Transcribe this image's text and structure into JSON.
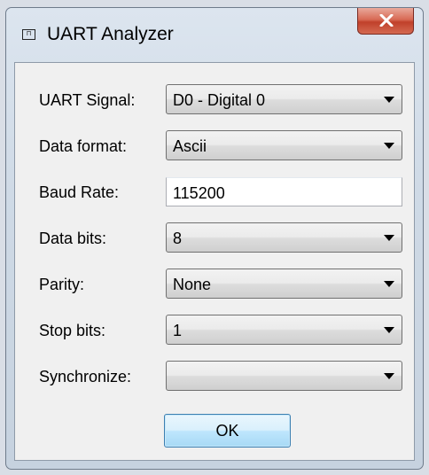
{
  "window": {
    "title": "UART Analyzer",
    "icon": "waveform-window-icon",
    "close_icon": "close-icon"
  },
  "form": {
    "uart_signal": {
      "label": "UART Signal:",
      "value": "D0 - Digital 0"
    },
    "data_format": {
      "label": "Data format:",
      "value": "Ascii"
    },
    "baud_rate": {
      "label": "Baud Rate:",
      "value": "115200"
    },
    "data_bits": {
      "label": "Data bits:",
      "value": "8"
    },
    "parity": {
      "label": "Parity:",
      "value": "None"
    },
    "stop_bits": {
      "label": "Stop bits:",
      "value": "1"
    },
    "synchronize": {
      "label": "Synchronize:",
      "value": ""
    }
  },
  "buttons": {
    "ok": "OK"
  },
  "colors": {
    "close_button": "#c8452f",
    "ok_button_border": "#3c7fb1",
    "client_background": "#f0f0f0"
  }
}
